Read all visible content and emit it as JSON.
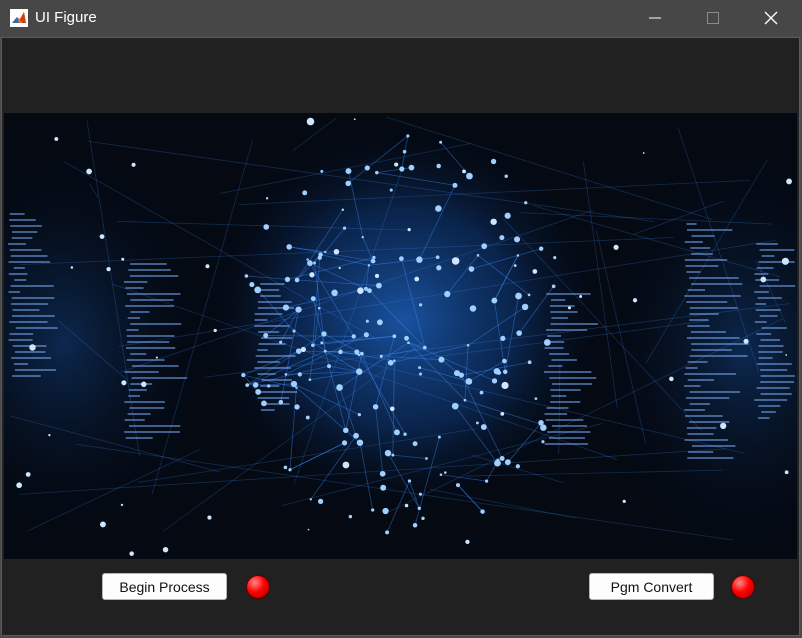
{
  "window": {
    "title": "UI Figure",
    "app_icon": "matlab-icon",
    "controls": [
      "minimize-icon",
      "maximize-icon",
      "close-icon"
    ]
  },
  "image": {
    "description_icon": "brain-network-image"
  },
  "buttons": {
    "begin_process": "Begin Process",
    "pgm_convert": "Pgm Convert"
  },
  "lamps": {
    "begin_lamp_color": "#ff0000",
    "pgm_lamp_color": "#ff0000"
  },
  "colors": {
    "figure_bg": "#212121",
    "titlebar_bg": "#474747",
    "accent_blue": "#3f8fff"
  }
}
